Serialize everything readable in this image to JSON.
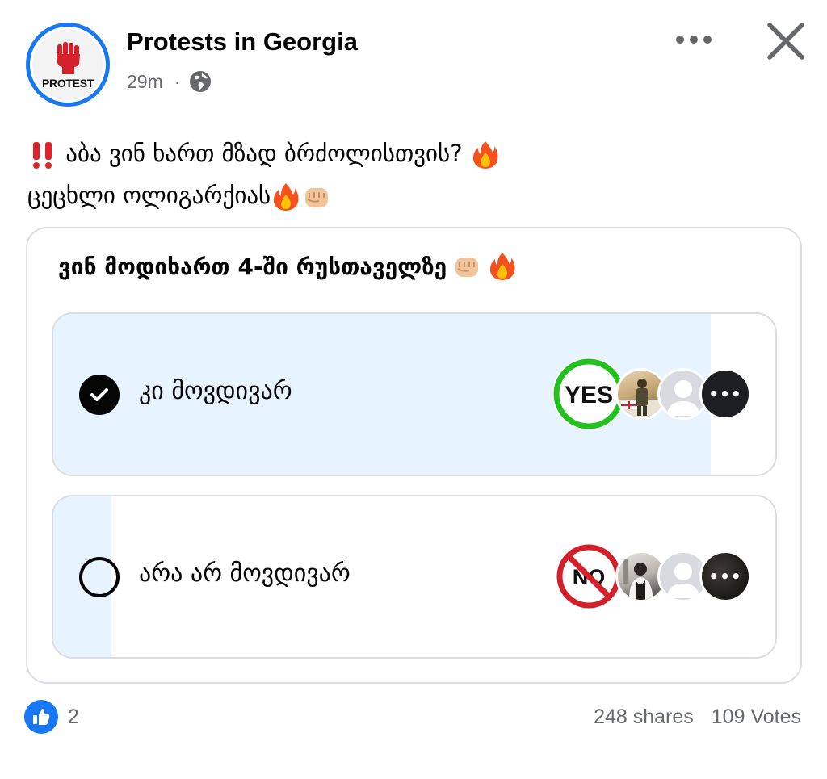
{
  "post": {
    "page_name": "Protests in Georgia",
    "avatar_text": "PROTEST",
    "time": "29m",
    "separator": "·",
    "visibility_icon": "globe-icon",
    "text_line1": "აბა ვინ ხართ მზად ბრძოლისთვის?",
    "text_line2": "ცეცხლი ოლიგარქიას"
  },
  "poll": {
    "question": "ვინ მოდიხართ 4-ში რუსთაველზე",
    "options": [
      {
        "label": "კი მოვდივარ",
        "selected": true,
        "fill_fraction": 0.91,
        "badge": "YES"
      },
      {
        "label": "არა არ მოვდივარ",
        "selected": false,
        "fill_fraction": 0.08,
        "badge": "NO"
      }
    ],
    "more_voters_label": "•••"
  },
  "footer": {
    "like_count": "2",
    "shares": "248 shares",
    "votes": "109 Votes"
  },
  "colors": {
    "accent": "#1877f2",
    "poll_fill": "#e7f3ff",
    "yes_ring": "#22c11e",
    "no_ring": "#d4202a",
    "secondary_text": "#65676b"
  }
}
